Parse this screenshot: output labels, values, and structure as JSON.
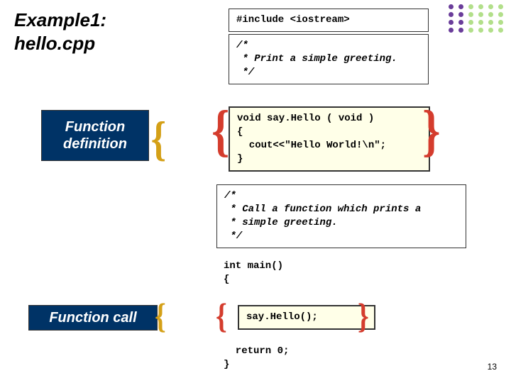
{
  "title_line1": "Example1:",
  "title_line2": "hello.cpp",
  "labels": {
    "definition": "Function definition",
    "call": "Function call"
  },
  "code": {
    "include": "#include <iostream>",
    "comment1": "/*\n * Print a simple greeting.\n */",
    "definition": "void say.Hello ( void )\n{\n  cout<<\"Hello World!\\n\";\n}",
    "comment2": "/*\n * Call a function which prints a\n * simple greeting.\n */",
    "main_open": "int main()\n{",
    "call": "say.Hello();",
    "main_close": "  return 0;\n}"
  },
  "page_number": "13"
}
